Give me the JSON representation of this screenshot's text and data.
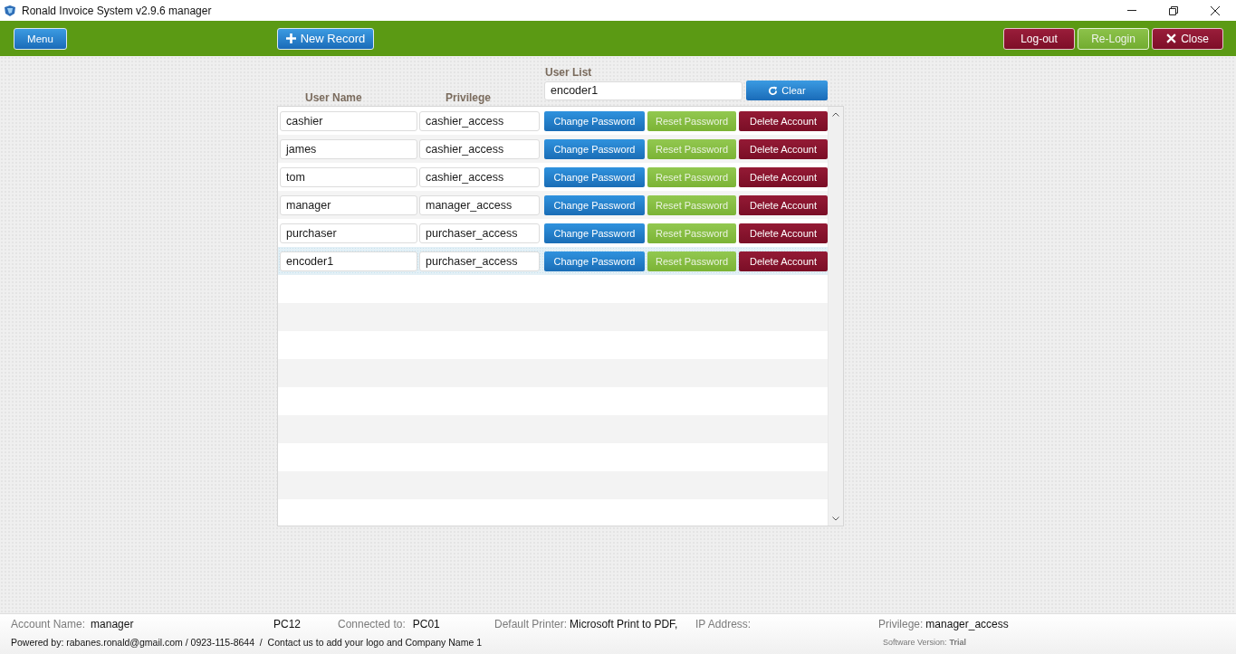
{
  "window": {
    "title": "Ronald Invoice System v2.9.6 manager"
  },
  "toolbar": {
    "left": [
      {
        "kind": "menu",
        "label": "Menu"
      },
      {
        "kind": "add",
        "label": "New Record"
      }
    ],
    "right": [
      {
        "kind": "logout",
        "label": "Log-out"
      },
      {
        "kind": "relogin",
        "label": "Re-Login"
      },
      {
        "kind": "close",
        "label": "Close"
      }
    ]
  },
  "user_list": {
    "label": "User List",
    "search": {
      "value": "encoder1"
    },
    "clear_button": "Clear"
  },
  "table": {
    "columns": [
      "User Name",
      "Privilege"
    ],
    "rows": [
      {
        "user_name": "cashier",
        "privilege": "cashier_access",
        "change_password": "Change Password",
        "reset_password": "Reset Password",
        "delete_account": "Delete Account",
        "selected": false
      },
      {
        "user_name": "james",
        "privilege": "cashier_access",
        "change_password": "Change Password",
        "reset_password": "Reset Password",
        "delete_account": "Delete Account",
        "selected": false
      },
      {
        "user_name": "tom",
        "privilege": "cashier_access",
        "change_password": "Change Password",
        "reset_password": "Reset Password",
        "delete_account": "Delete Account",
        "selected": false
      },
      {
        "user_name": "manager",
        "privilege": "manager_access",
        "change_password": "Change Password",
        "reset_password": "Reset Password",
        "delete_account": "Delete Account",
        "selected": false
      },
      {
        "user_name": "purchaser",
        "privilege": "purchaser_access",
        "change_password": "Change Password",
        "reset_password": "Reset Password",
        "delete_account": "Delete Account",
        "selected": false
      },
      {
        "user_name": "encoder1",
        "privilege": "purchaser_access",
        "change_password": "Change Password",
        "reset_password": "Reset Password",
        "delete_account": "Delete Account",
        "selected": true
      }
    ]
  },
  "status_bar": {
    "account_name": {
      "label": "Account Name:",
      "value": "manager"
    },
    "computer": "PC12",
    "connected_to": {
      "label": "Connected to:",
      "value": "PC01"
    },
    "default_printer": {
      "label": "Default Printer:",
      "value": "Microsoft Print to PDF,"
    },
    "ip_address": {
      "label": "IP Address:"
    },
    "privilege": {
      "label": "Privilege:",
      "value": "manager_access"
    },
    "powered_by": "Powered by: rabanes.ronald@gmail.com / 0923-115-8644  /  Contact us to add your logo and Company Name 1",
    "software_version": {
      "label": "Software Version:",
      "value": "Trial"
    }
  }
}
